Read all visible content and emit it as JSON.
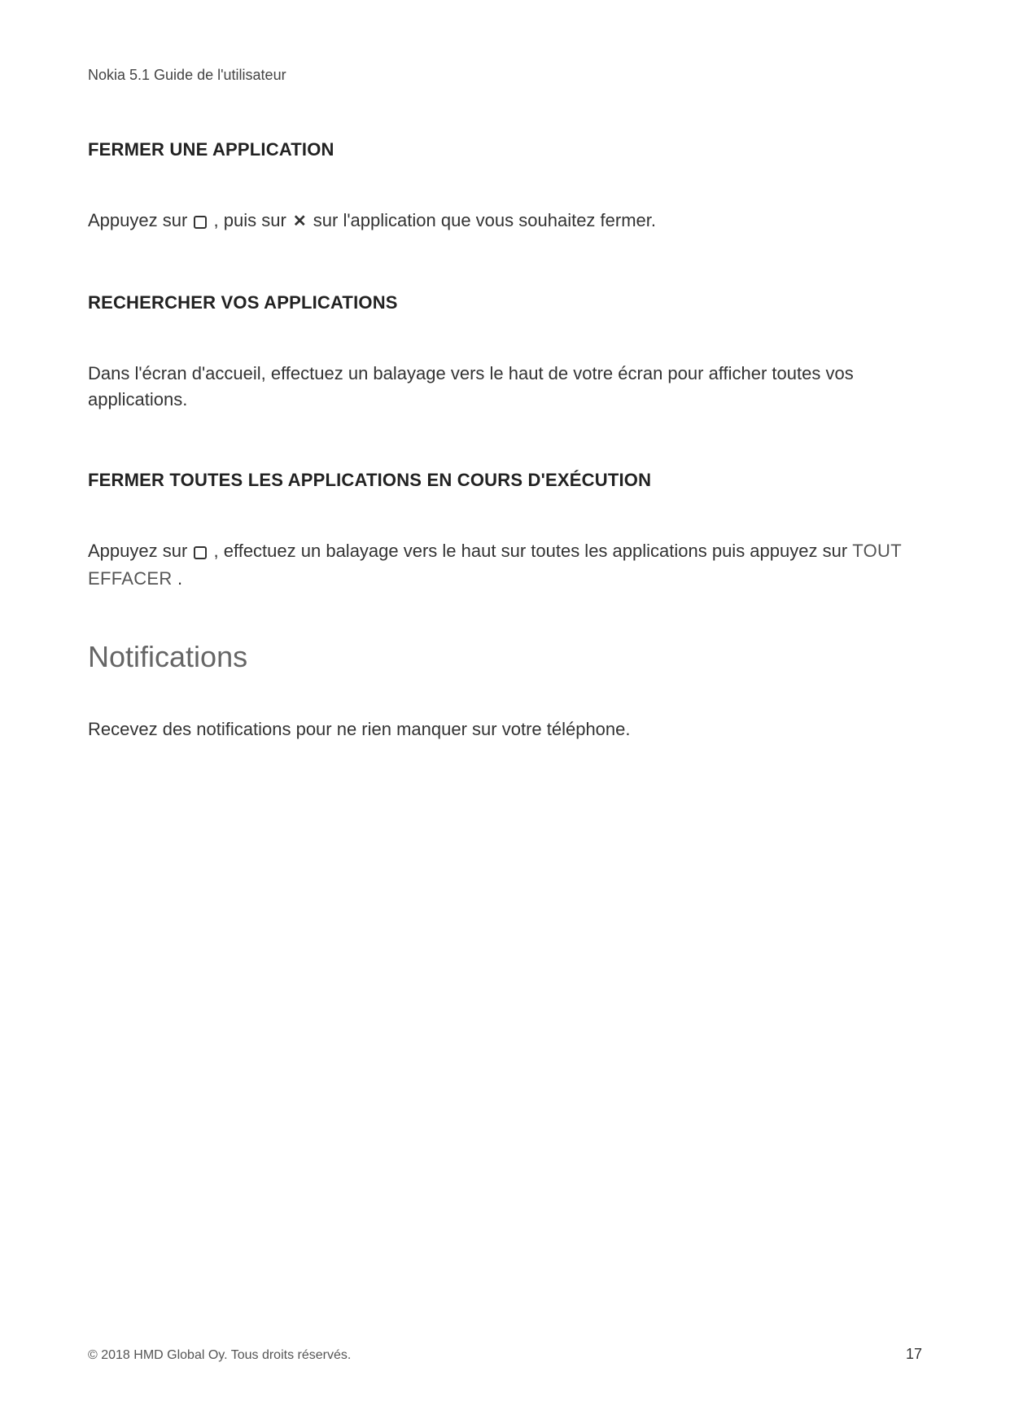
{
  "header": {
    "doc_title": "Nokia 5.1 Guide de l'utilisateur"
  },
  "sections": {
    "s1": {
      "heading": "FERMER UNE APPLICATION",
      "p1_a": "Appuyez sur ",
      "p1_b": ", puis sur ",
      "p1_c": " sur l'application que vous souhaitez fermer."
    },
    "s2": {
      "heading": "RECHERCHER VOS APPLICATIONS",
      "p1": "Dans l'écran d'accueil, effectuez un balayage vers le haut de votre écran pour afficher toutes vos applications."
    },
    "s3": {
      "heading": "FERMER TOUTES LES APPLICATIONS EN COURS D'EXÉCUTION",
      "p1_a": "Appuyez sur ",
      "p1_b": ", effectuez un balayage vers le haut sur toutes les applications puis appuyez sur ",
      "ui_label": " TOUT EFFACER ",
      "p1_c": "."
    },
    "s4": {
      "heading": "Notifications",
      "p1": "Recevez des notifications pour ne rien manquer sur votre téléphone."
    }
  },
  "icons": {
    "close_x": "✕"
  },
  "footer": {
    "copyright": "© 2018 HMD Global Oy. Tous droits réservés.",
    "page_number": "17"
  }
}
